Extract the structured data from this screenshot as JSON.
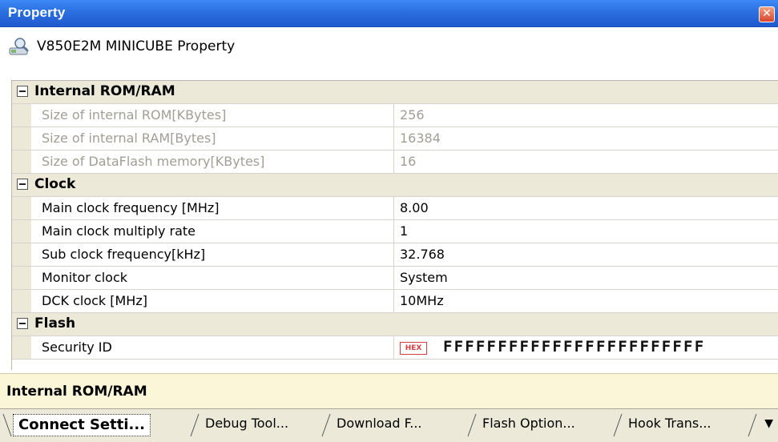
{
  "window": {
    "title": "Property",
    "close_glyph": "✕"
  },
  "header": {
    "object_name": "V850E2M MINICUBE Property",
    "icon": "debugger-tool-icon"
  },
  "grid": {
    "categories": [
      {
        "label": "Internal ROM/RAM",
        "expanded": true,
        "rows": [
          {
            "name": "Size of internal ROM[KBytes]",
            "value": "256",
            "disabled": true
          },
          {
            "name": "Size of internal RAM[Bytes]",
            "value": "16384",
            "disabled": true
          },
          {
            "name": "Size of DataFlash memory[KBytes]",
            "value": "16",
            "disabled": true
          }
        ]
      },
      {
        "label": "Clock",
        "expanded": true,
        "rows": [
          {
            "name": "Main clock frequency [MHz]",
            "value": "8.00",
            "disabled": false
          },
          {
            "name": "Main clock multiply rate",
            "value": "1",
            "disabled": false
          },
          {
            "name": "Sub clock frequency[kHz]",
            "value": "32.768",
            "disabled": false
          },
          {
            "name": "Monitor clock",
            "value": "System",
            "disabled": false
          },
          {
            "name": "DCK clock [MHz]",
            "value": "10MHz",
            "disabled": false
          }
        ]
      },
      {
        "label": "Flash",
        "expanded": true,
        "rows": [
          {
            "name": "Security ID",
            "badge": "HEX",
            "value": "FFFFFFFFFFFFFFFFFFFFFFFF",
            "disabled": false
          }
        ]
      }
    ]
  },
  "description": {
    "title": "Internal ROM/RAM"
  },
  "tabs": {
    "items": [
      {
        "label": "Connect Setti...",
        "active": true
      },
      {
        "label": "Debug Tool...",
        "active": false
      },
      {
        "label": "Download F...",
        "active": false
      },
      {
        "label": "Flash Option...",
        "active": false
      },
      {
        "label": "Hook Trans...",
        "active": false
      }
    ],
    "menu_glyph": "▼"
  },
  "colors": {
    "titlebar": "#2b6fe0",
    "category_bg": "#ece9d8",
    "disabled_text": "#a19e94",
    "description_bg": "#fbf6d8",
    "hex_badge": "#d04040"
  }
}
